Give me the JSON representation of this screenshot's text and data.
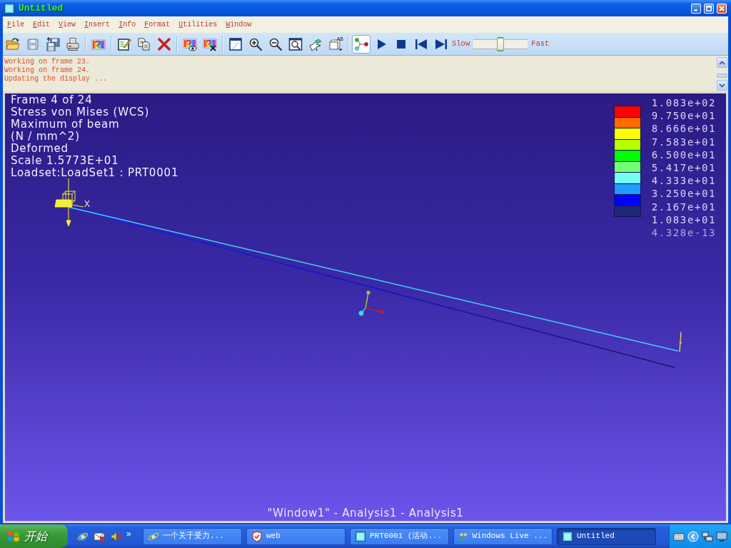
{
  "window": {
    "title": "Untitled"
  },
  "menu": [
    "File",
    "Edit",
    "View",
    "Insert",
    "Info",
    "Format",
    "Utilities",
    "Window"
  ],
  "toolbar": {
    "label_tool_text": "AB",
    "display_toggle": {
      "pressed": true
    },
    "speed": {
      "slow_label": "Slow",
      "fast_label": "Fast",
      "level": 0.5
    }
  },
  "messages": [
    "Working on frame 23.",
    "Working on frame 24.",
    "Updating the display ..."
  ],
  "viewport": {
    "info_lines": [
      "Frame 4 of 24",
      "Stress von Mises (WCS)",
      "Maximum of beam",
      "(N / mm^2)",
      "Deformed",
      "Scale 1.5773E+01",
      "Loadset:LoadSet1 : PRT0001"
    ],
    "axis_label": "X",
    "legend": {
      "labels": [
        "1.083e+02",
        "9.750e+01",
        "8.666e+01",
        "7.583e+01",
        "6.500e+01",
        "5.417e+01",
        "4.333e+01",
        "3.250e+01",
        "2.167e+01",
        "1.083e+01",
        "4.328e-13"
      ],
      "bands": [
        {
          "color": "#ff0000"
        },
        {
          "color": "#ff6a00"
        },
        {
          "color": "#ffff00"
        },
        {
          "color": "#b4ff00"
        },
        {
          "color": "#00ff00"
        },
        {
          "color": "#74ff74"
        },
        {
          "color": "#72fff0"
        },
        {
          "color": "#1e9cff"
        },
        {
          "color": "#0000ff"
        },
        {
          "color": "#1c2878"
        }
      ]
    },
    "caption": "\"Window1\" - Analysis1 - Analysis1"
  },
  "taskbar": {
    "start_label": "开始",
    "more": "»",
    "tasks": [
      {
        "label": "一个关于受力...",
        "selected": false
      },
      {
        "label": "web",
        "selected": false
      },
      {
        "label": "PRT0001 (活动...",
        "selected": false
      },
      {
        "label": "Windows Live ...",
        "selected": false
      },
      {
        "label": "Untitled",
        "selected": true
      }
    ]
  }
}
